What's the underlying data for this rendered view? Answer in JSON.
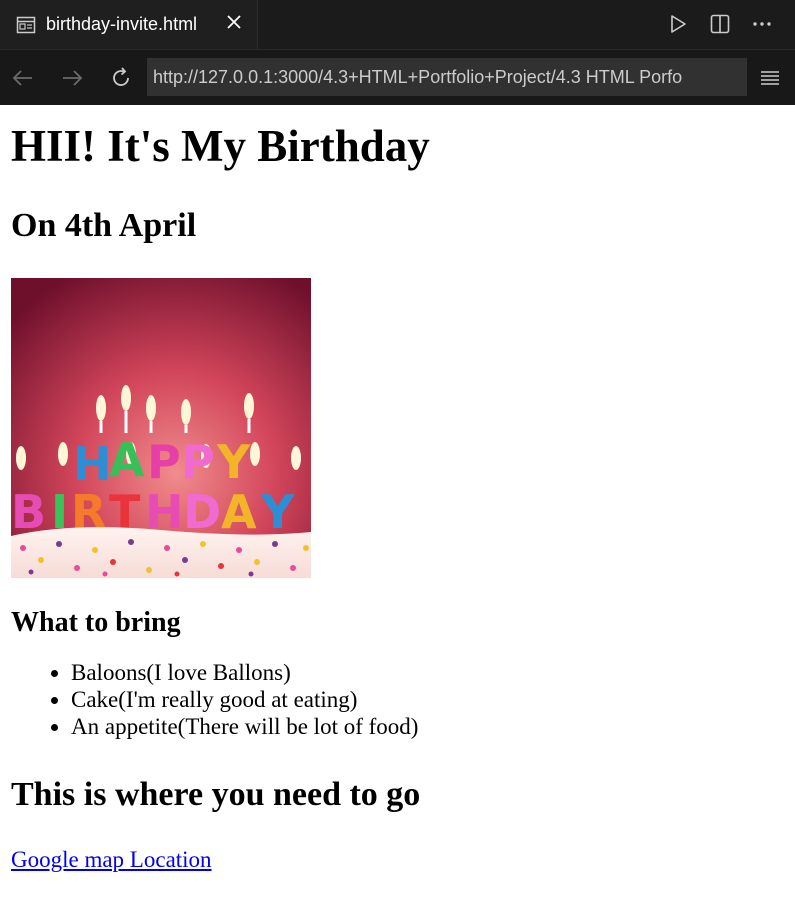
{
  "tab": {
    "title": "birthday-invite.html",
    "icon": "preview-icon",
    "actions": [
      "play-icon",
      "split-editor-icon",
      "more-icon"
    ]
  },
  "toolbar": {
    "url": "http://127.0.0.1:3000/4.3+HTML+Portfolio+Project/4.3 HTML Porfo"
  },
  "page": {
    "heading": "HII! It's My Birthday",
    "date": "On 4th April",
    "image": {
      "letters_top": "HAPPY",
      "letters_bottom": "BIRTHDAY"
    },
    "bring_heading": "What to bring",
    "bring_items": [
      "Baloons(I love Ballons)",
      "Cake(I'm really good at eating)",
      "An appetite(There will be lot of food)"
    ],
    "location_heading": "This is where you need to go",
    "map_link": "Google map Location"
  },
  "colors": {
    "tab_bg": "#1f1f1f",
    "toolbar_bg": "#181818",
    "url_bg": "#313131",
    "link": "#0000ee"
  }
}
